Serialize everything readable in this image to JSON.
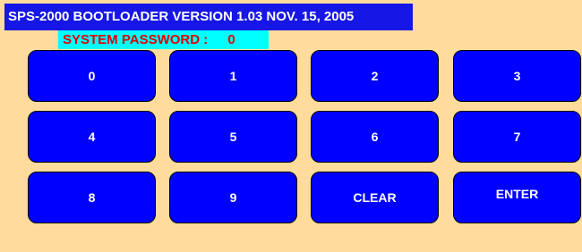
{
  "title": "SPS-2000 BOOTLOADER VERSION 1.03 NOV. 15, 2005",
  "password": {
    "label": "SYSTEM PASSWORD :",
    "value": "0"
  },
  "keypad": {
    "k0": "0",
    "k1": "1",
    "k2": "2",
    "k3": "3",
    "k4": "4",
    "k5": "5",
    "k6": "6",
    "k7": "7",
    "k8": "8",
    "k9": "9",
    "clear": "CLEAR",
    "enter": "ENTER"
  },
  "colors": {
    "background": "#FFDB9C",
    "title_bar": "#1616E6",
    "password_box": "#00FFFF",
    "password_text": "#E00000",
    "key_fill": "#0000FF",
    "key_text": "#FFFFFF"
  }
}
